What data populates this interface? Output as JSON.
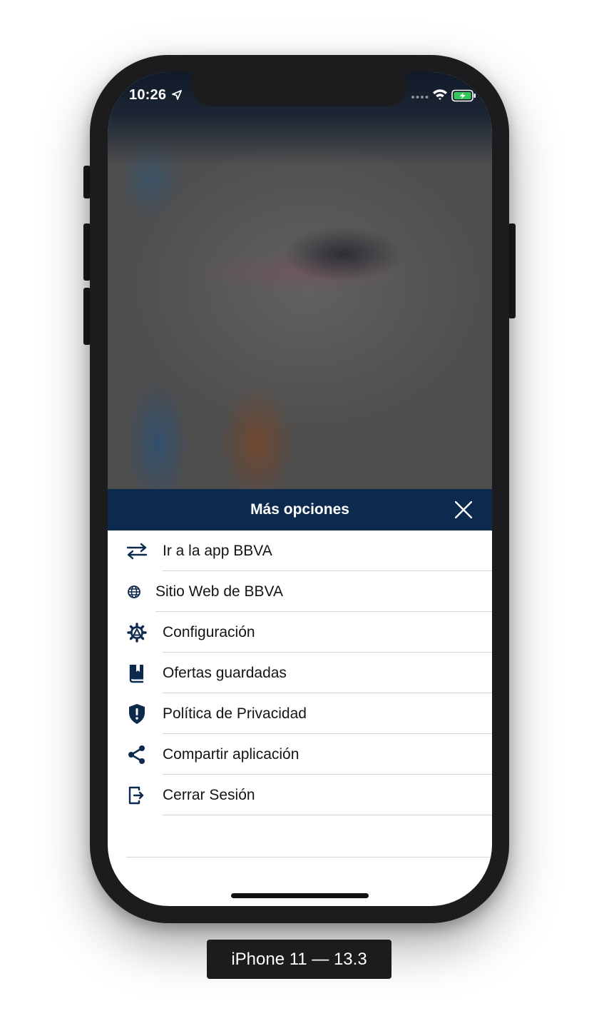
{
  "status_bar": {
    "time": "10:26",
    "location_icon": "location-arrow-icon",
    "signal_icon": "cellular-signal-icon",
    "wifi_icon": "wifi-icon",
    "battery_icon": "battery-charging-icon"
  },
  "sheet": {
    "title": "Más opciones",
    "close_icon": "close-icon",
    "header_color": "#0c2a4d",
    "items": [
      {
        "label": "Ir a la app BBVA",
        "icon": "swap-arrows-icon"
      },
      {
        "label": "Sitio Web de BBVA",
        "icon": "globe-icon"
      },
      {
        "label": "Configuración",
        "icon": "gear-icon"
      },
      {
        "label": "Ofertas guardadas",
        "icon": "bookmark-icon"
      },
      {
        "label": "Política de Privacidad",
        "icon": "shield-alert-icon"
      },
      {
        "label": "Compartir aplicación",
        "icon": "share-icon"
      },
      {
        "label": "Cerrar Sesión",
        "icon": "logout-icon"
      }
    ]
  },
  "device_caption": "iPhone 11 — 13.3",
  "colors": {
    "accent": "#0c2a4d",
    "battery_fill": "#34c759"
  }
}
